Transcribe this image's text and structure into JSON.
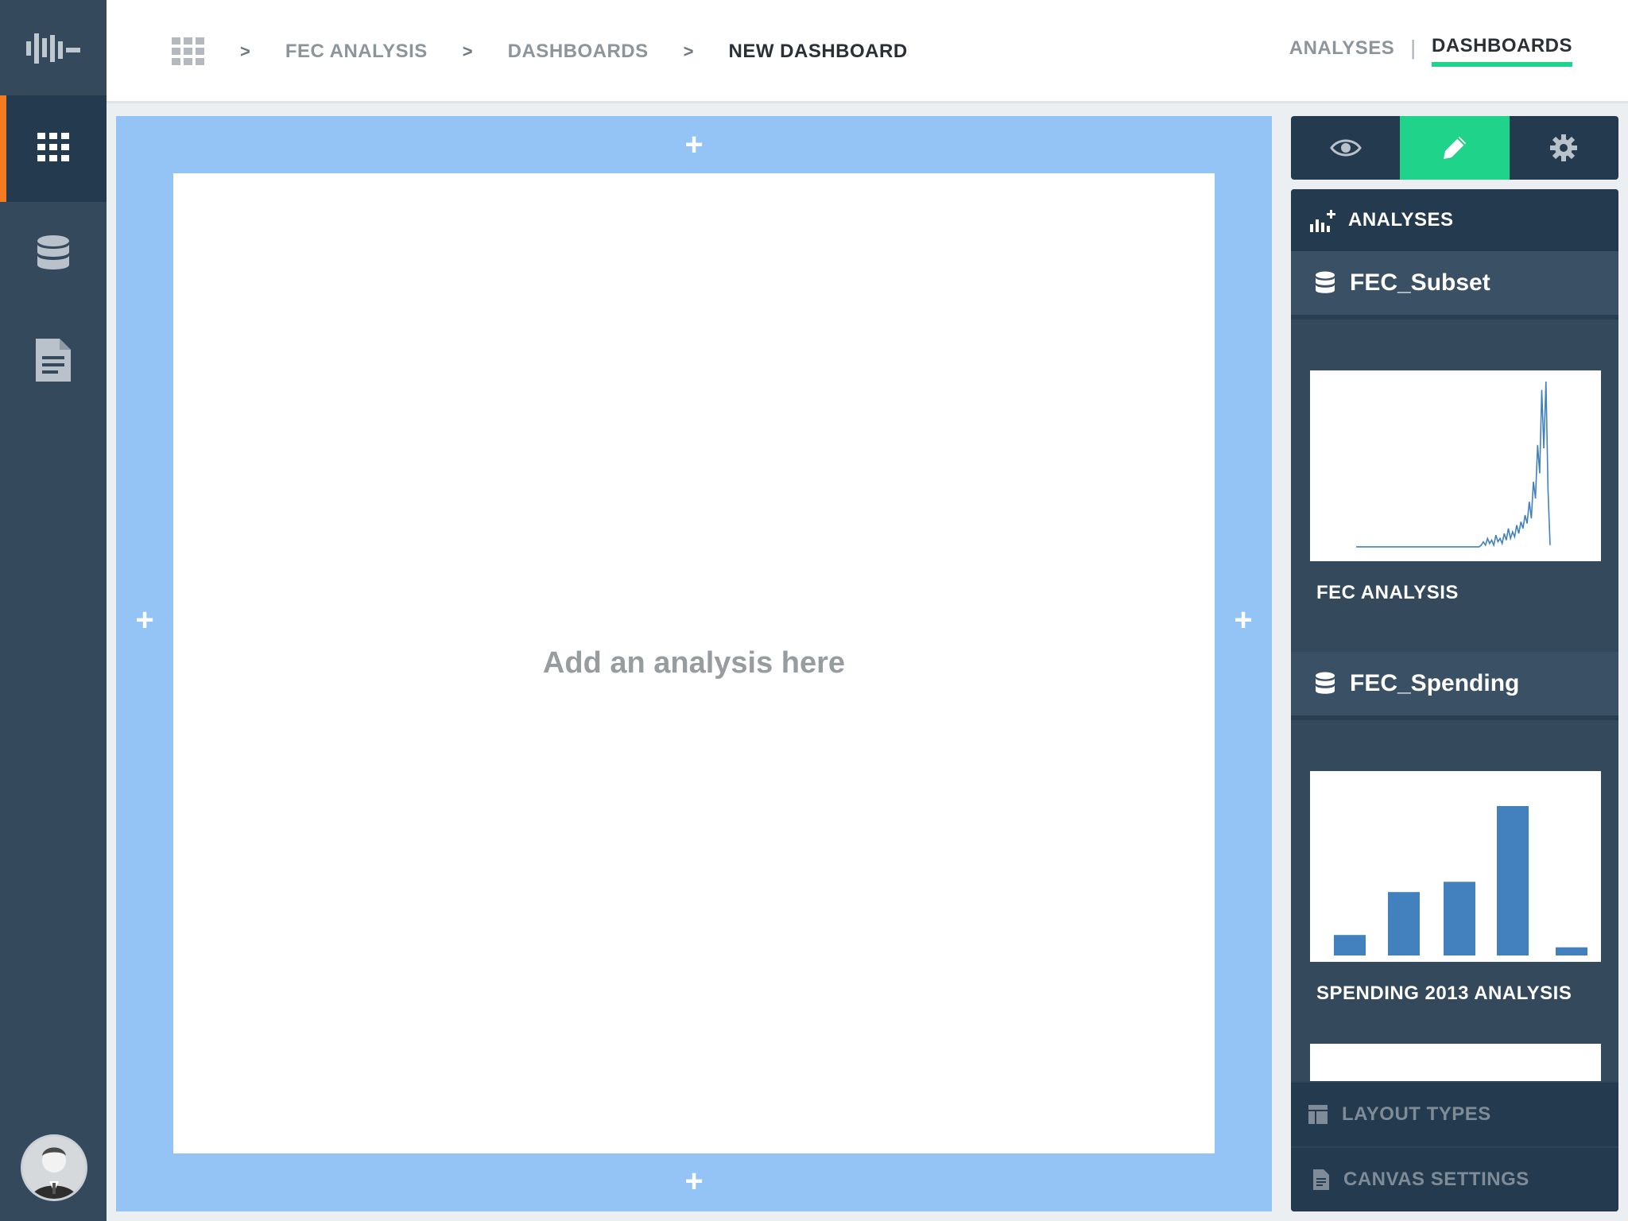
{
  "rail": {
    "logo_icon": "brand-logo-icon",
    "items": [
      {
        "icon": "grid-icon",
        "active": true
      },
      {
        "icon": "database-icon",
        "active": false
      },
      {
        "icon": "document-icon",
        "active": false
      }
    ]
  },
  "breadcrumb": {
    "home_icon": "apps-grid-icon",
    "items": [
      "FEC ANALYSIS",
      "DASHBOARDS",
      "NEW DASHBOARD"
    ],
    "separator": ">"
  },
  "top_nav": {
    "analyses": "ANALYSES",
    "divider": "|",
    "dashboards": "DASHBOARDS",
    "active_color": "#1fd38a"
  },
  "canvas": {
    "placeholder": "Add an analysis here",
    "add_symbol": "+",
    "background_color": "#93c4f5"
  },
  "panel": {
    "modes": [
      {
        "icon": "eye-icon",
        "active": false
      },
      {
        "icon": "pencil-icon",
        "active": true
      },
      {
        "icon": "gear-icon",
        "active": false
      }
    ],
    "header": "ANALYSES",
    "datasets": [
      {
        "name": "FEC_Subset",
        "analysis_title": "FEC ANALYSIS",
        "chart_data": {
          "type": "line",
          "title": "",
          "xlabel": "",
          "ylabel": "",
          "values": [
            1,
            1,
            1,
            1,
            1,
            1,
            1,
            1,
            1,
            1,
            1,
            1,
            1,
            1,
            1,
            1,
            1,
            1,
            1,
            1,
            1,
            1,
            1,
            1,
            1,
            1,
            1,
            1,
            1,
            1,
            1,
            1,
            1,
            1,
            1,
            1,
            1,
            1,
            1,
            1,
            1,
            1,
            1,
            1,
            1,
            1,
            1,
            1,
            1,
            1,
            1,
            1,
            1,
            1,
            1,
            1,
            1,
            1,
            1,
            1,
            2,
            4,
            2,
            6,
            3,
            5,
            2,
            8,
            4,
            6,
            3,
            9,
            5,
            12,
            6,
            10,
            7,
            14,
            9,
            16,
            12,
            20,
            15,
            28,
            18,
            40,
            30,
            62,
            45,
            95,
            60,
            100,
            35,
            2
          ]
        }
      },
      {
        "name": "FEC_Spending",
        "analysis_title": "SPENDING 2013 ANALYSIS",
        "chart_data": {
          "type": "bar",
          "title": "",
          "xlabel": "",
          "ylabel": "",
          "values": [
            10,
            31,
            36,
            73,
            4
          ]
        }
      }
    ],
    "footer": {
      "layout_types": "LAYOUT TYPES",
      "canvas_settings": "CANVAS SETTINGS"
    }
  },
  "colors": {
    "rail_bg": "#34495c",
    "rail_active_bg": "#243a4e",
    "rail_accent": "#f47b20",
    "chart_blue": "#4281bd"
  }
}
